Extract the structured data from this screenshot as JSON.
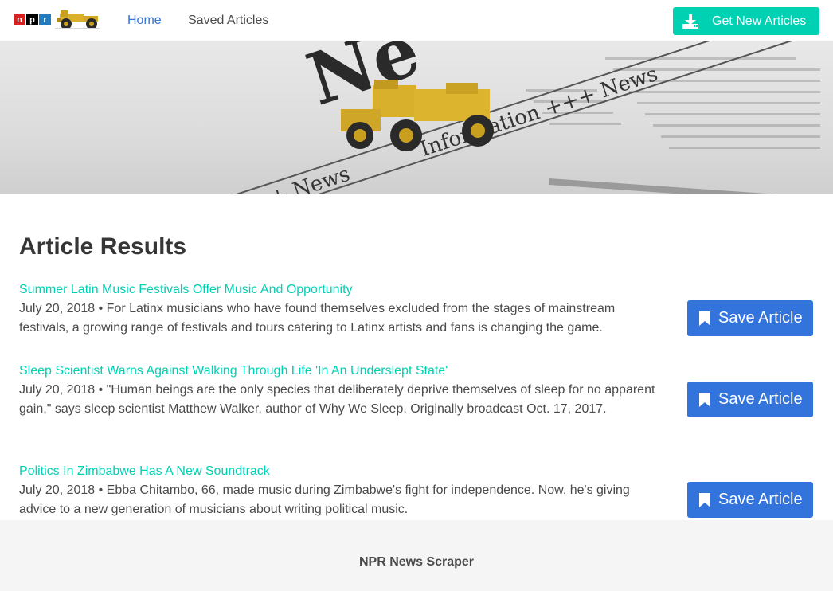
{
  "navbar": {
    "brand_letters": [
      "n",
      "p",
      "r"
    ],
    "links": [
      {
        "label": "Home"
      },
      {
        "label": "Saved Articles"
      }
    ],
    "get_button_label": "Get New Articles"
  },
  "hero": {
    "newspaper_words": [
      "Information +++ News",
      "+++ Information +++ News",
      "Ne"
    ]
  },
  "main": {
    "section_title": "Article Results",
    "articles": [
      {
        "title": "Summer Latin Music Festivals Offer Music And Opportunity",
        "summary": "July 20, 2018 • For Latinx musicians who have found themselves excluded from the stages of mainstream festivals, a growing range of festivals and tours catering to Latinx artists and fans is changing the game.",
        "save_label": "Save Article"
      },
      {
        "title": "Sleep Scientist Warns Against Walking Through Life 'In An Underslept State'",
        "summary": "July 20, 2018 • \"Human beings are the only species that deliberately deprive themselves of sleep for no apparent gain,\" says sleep scientist Matthew Walker, author of Why We Sleep. Originally broadcast Oct. 17, 2017.",
        "save_label": "Save Article"
      },
      {
        "title": "Politics In Zimbabwe Has A New Soundtrack",
        "summary": "July 20, 2018 • Ebba Chitambo, 66, made music during Zimbabwe's fight for independence. Now, he's giving advice to a new generation of musicians about writing political music.",
        "save_label": "Save Article"
      }
    ]
  },
  "footer": {
    "text": "NPR News Scraper"
  },
  "colors": {
    "link": "#3273dc",
    "primary": "#00d1b2",
    "save": "#3273dc"
  }
}
